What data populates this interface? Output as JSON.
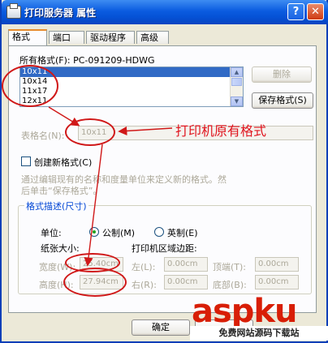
{
  "window": {
    "title": "打印服务器 属性",
    "help_glyph": "?",
    "close_glyph": "✕"
  },
  "tabs": [
    "格式",
    "端口",
    "驱动程序",
    "高级"
  ],
  "forms": {
    "all_formats_label": "所有格式(F): PC-091209-HDWG",
    "items": [
      "10x11",
      "10x14",
      "11x17",
      "12x11"
    ],
    "selected_index": 0,
    "delete_button": "删除",
    "save_button": "保存格式(S)",
    "form_name_label": "表格名(N):",
    "form_name_value": "10x11",
    "create_new_label": "创建新格式(C)",
    "hint_text_line1": "通过编辑现有的名称和度量单位来定义新的格式。然",
    "hint_text_line2": "后单击“保存格式”。"
  },
  "description": {
    "group_title": "格式描述(尺寸)",
    "unit_label": "单位:",
    "metric_label": "公制(M)",
    "english_label": "英制(E)",
    "paper_size_label": "纸张大小:",
    "margins_label": "打印机区域边距:",
    "width_label": "宽度(W):",
    "width_value": "25.40cm",
    "height_label": "高度(H):",
    "height_value": "27.94cm",
    "left_label": "左(L):",
    "left_value": "0.00cm",
    "right_label": "右(R):",
    "right_value": "0.00cm",
    "top_label": "顶端(T):",
    "top_value": "0.00cm",
    "bottom_label": "底部(B):",
    "bottom_value": "0.00cm"
  },
  "footer": {
    "ok_button": "确定"
  },
  "annotation": {
    "text": "打印机原有格式",
    "color": "#e0141e"
  },
  "watermark": {
    "brand": "aspku",
    "sub": "免费网站源码下载站"
  }
}
